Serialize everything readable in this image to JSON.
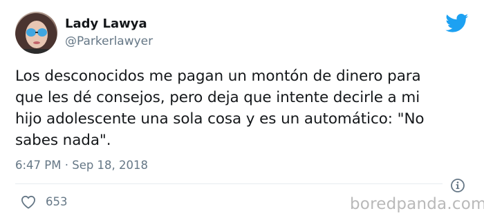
{
  "author": {
    "name": "Lady Lawya",
    "handle": "@Parkerlawyer"
  },
  "tweet": {
    "lines": [
      "Los desconocidos me pagan un montón de dinero para",
      "que les dé consejos, pero deja que intente decirle a mi",
      "hijo adolescente una sola cosa y es un automático: \"No",
      "sabes nada\"."
    ],
    "timestamp": "6:47 PM · Sep 18, 2018"
  },
  "engagement": {
    "likes": "653"
  },
  "watermark": "boredpanda.com",
  "icons": {
    "brand": "twitter-bird-icon",
    "info": "info-icon",
    "like": "heart-icon"
  },
  "colors": {
    "twitter_blue": "#1da1f2",
    "text_primary": "#14171a",
    "text_secondary": "#657786",
    "divider": "#e6ecf0",
    "watermark": "#b9b9b9"
  }
}
